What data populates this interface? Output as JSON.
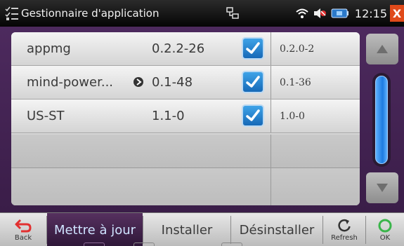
{
  "titlebar": {
    "title": "Gestionnaire d'application",
    "clock": "12:15",
    "close_label": "X"
  },
  "packages": [
    {
      "name": "appmg",
      "version": "0.2.2-26",
      "checked": true,
      "installed_version": "0.2.0-2",
      "has_info": false
    },
    {
      "name": "mind-power...",
      "version": "0.1-48",
      "checked": true,
      "installed_version": "0.1-36",
      "has_info": true
    },
    {
      "name": "US-ST",
      "version": "1.1-0",
      "checked": true,
      "installed_version": "1.0-0",
      "has_info": false
    }
  ],
  "toolbar": {
    "back_label": "Back",
    "update_label": "Mettre à jour",
    "install_label": "Installer",
    "uninstall_label": "Désinstaller",
    "refresh_label": "Refresh",
    "ok_label": "OK"
  },
  "scroll": {
    "position": 0.0
  },
  "colors": {
    "accent": "#1d7be0",
    "background": "#4d2a5e",
    "close": "#e04a1a"
  },
  "icons": {
    "app": "checklist-icon",
    "network": "network-icon",
    "wifi": "wifi-icon",
    "mute": "mute-icon",
    "battery": "battery-icon",
    "back": "back-arrow-icon",
    "refresh": "refresh-icon",
    "ok": "ok-circle-icon"
  }
}
